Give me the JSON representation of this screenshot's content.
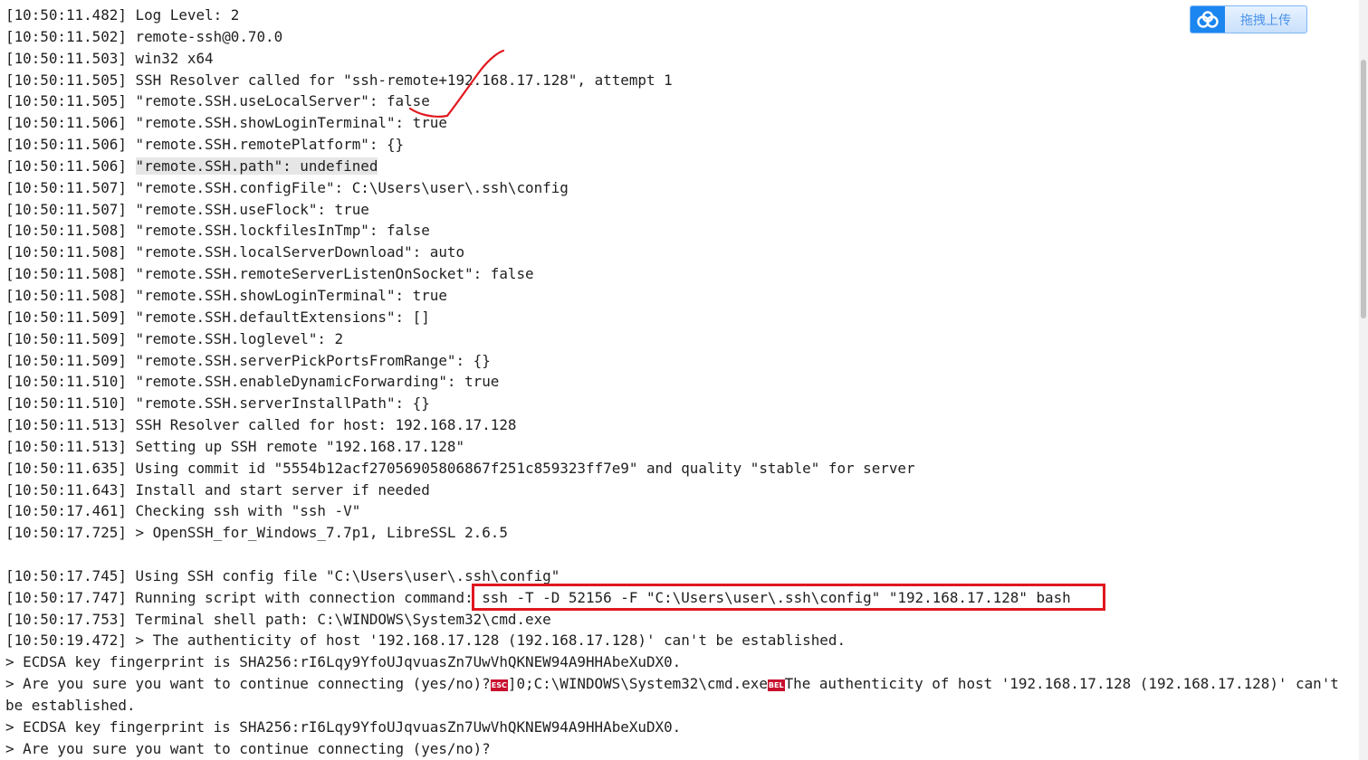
{
  "upload_button": {
    "label": "拖拽上传",
    "icon": "cloud-icon"
  },
  "log_lines": [
    {
      "ts": "[10:50:11.482]",
      "text": " Log Level: 2"
    },
    {
      "ts": "[10:50:11.502]",
      "text": " remote-ssh@0.70.0"
    },
    {
      "ts": "[10:50:11.503]",
      "text": " win32 x64"
    },
    {
      "ts": "[10:50:11.505]",
      "text": " SSH Resolver called for \"ssh-remote+192.168.17.128\", attempt 1"
    },
    {
      "ts": "[10:50:11.505]",
      "text": " \"remote.SSH.useLocalServer\": false"
    },
    {
      "ts": "[10:50:11.506]",
      "text": " \"remote.SSH.showLoginTerminal\": true"
    },
    {
      "ts": "[10:50:11.506]",
      "text": " \"remote.SSH.remotePlatform\": {}"
    },
    {
      "ts": "[10:50:11.506]",
      "text": " ",
      "highlight": "\"remote.SSH.path\": undefined"
    },
    {
      "ts": "[10:50:11.507]",
      "text": " \"remote.SSH.configFile\": C:\\Users\\user\\.ssh\\config"
    },
    {
      "ts": "[10:50:11.507]",
      "text": " \"remote.SSH.useFlock\": true"
    },
    {
      "ts": "[10:50:11.508]",
      "text": " \"remote.SSH.lockfilesInTmp\": false"
    },
    {
      "ts": "[10:50:11.508]",
      "text": " \"remote.SSH.localServerDownload\": auto"
    },
    {
      "ts": "[10:50:11.508]",
      "text": " \"remote.SSH.remoteServerListenOnSocket\": false"
    },
    {
      "ts": "[10:50:11.508]",
      "text": " \"remote.SSH.showLoginTerminal\": true"
    },
    {
      "ts": "[10:50:11.509]",
      "text": " \"remote.SSH.defaultExtensions\": []"
    },
    {
      "ts": "[10:50:11.509]",
      "text": " \"remote.SSH.loglevel\": 2"
    },
    {
      "ts": "[10:50:11.509]",
      "text": " \"remote.SSH.serverPickPortsFromRange\": {}"
    },
    {
      "ts": "[10:50:11.510]",
      "text": " \"remote.SSH.enableDynamicForwarding\": true"
    },
    {
      "ts": "[10:50:11.510]",
      "text": " \"remote.SSH.serverInstallPath\": {}"
    },
    {
      "ts": "[10:50:11.513]",
      "text": " SSH Resolver called for host: 192.168.17.128"
    },
    {
      "ts": "[10:50:11.513]",
      "text": " Setting up SSH remote \"192.168.17.128\""
    },
    {
      "ts": "[10:50:11.635]",
      "text": " Using commit id \"5554b12acf27056905806867f251c859323ff7e9\" and quality \"stable\" for server"
    },
    {
      "ts": "[10:50:11.643]",
      "text": " Install and start server if needed"
    },
    {
      "ts": "[10:50:17.461]",
      "text": " Checking ssh with \"ssh -V\""
    },
    {
      "ts": "[10:50:17.725]",
      "text": " > OpenSSH_for_Windows_7.7p1, LibreSSL 2.6.5"
    },
    {
      "ts": "",
      "text": ""
    },
    {
      "ts": "[10:50:17.745]",
      "text": " Using SSH config file \"C:\\Users\\user\\.ssh\\config\""
    },
    {
      "ts": "[10:50:17.747]",
      "text": " Running script with connection command: ssh -T -D 52156 -F \"C:\\Users\\user\\.ssh\\config\" \"192.168.17.128\" bash"
    },
    {
      "ts": "[10:50:17.753]",
      "text": " Terminal shell path: C:\\WINDOWS\\System32\\cmd.exe"
    },
    {
      "ts": "[10:50:19.472]",
      "text": " > The authenticity of host '192.168.17.128 (192.168.17.128)' can't be established."
    },
    {
      "ts": "",
      "text": "> ECDSA key fingerprint is SHA256:rI6Lqy9YfoUJqvuasZn7UwVhQKNEW94A9HHAbeXuDX0."
    },
    {
      "ts": "",
      "text": "> Are you sure you want to continue connecting (yes/no)?",
      "ctrl1": "ESC",
      "mid": "]0;C:\\WINDOWS\\System32\\cmd.exe",
      "ctrl2": "BEL",
      "tail": "The authenticity of host '192.168.17.128 (192.168.17.128)' can't be established."
    },
    {
      "ts": "",
      "text": "> ECDSA key fingerprint is SHA256:rI6Lqy9YfoUJqvuasZn7UwVhQKNEW94A9HHAbeXuDX0."
    },
    {
      "ts": "",
      "text": "> Are you sure you want to continue connecting (yes/no)?"
    }
  ],
  "colors": {
    "annotation_red": "#e0181f",
    "ctrl_badge": "#c8102e",
    "highlight_bg": "#e6e6e6",
    "upload_accent": "#1b86f0"
  }
}
